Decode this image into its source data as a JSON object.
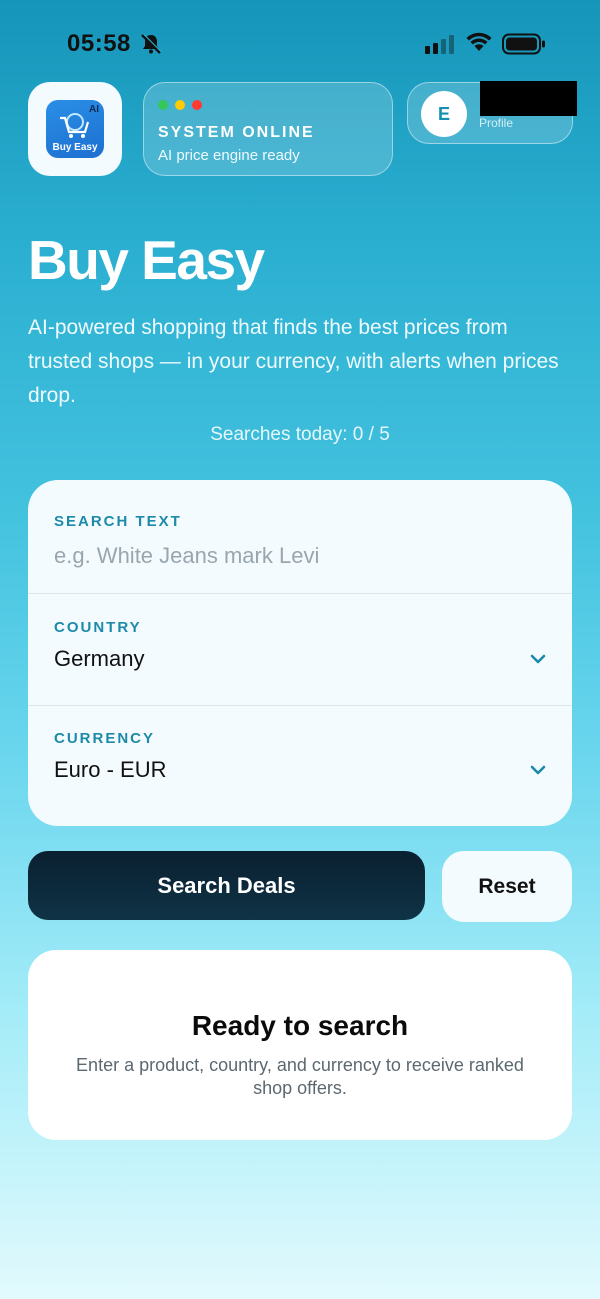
{
  "status_bar": {
    "time": "05:58"
  },
  "header": {
    "logo": {
      "badge": "AI",
      "name": "Buy Easy"
    },
    "system": {
      "title": "SYSTEM ONLINE",
      "subtitle": "AI price engine ready",
      "dot_colors": [
        "#34c759",
        "#ffcc00",
        "#ff3b30"
      ]
    },
    "profile": {
      "initial": "E",
      "label": "Profile"
    }
  },
  "hero": {
    "title": "Buy Easy",
    "description": "AI-powered shopping that finds the best prices from trusted shops — in your currency, with alerts when prices drop.",
    "searches_today": "Searches today: 0 / 5"
  },
  "form": {
    "search": {
      "label": "SEARCH TEXT",
      "placeholder": "e.g. White Jeans mark Levi",
      "value": ""
    },
    "country": {
      "label": "COUNTRY",
      "value": "Germany"
    },
    "currency": {
      "label": "CURRENCY",
      "value": "Euro - EUR"
    }
  },
  "actions": {
    "search_label": "Search Deals",
    "reset_label": "Reset"
  },
  "ready": {
    "title": "Ready to search",
    "description": "Enter a product, country, and currency to receive ranked shop offers."
  },
  "colors": {
    "accent": "#1c8aa8",
    "primary_button": "#0a2030"
  }
}
